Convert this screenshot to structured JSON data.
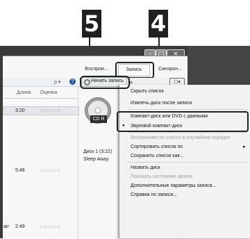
{
  "callouts": {
    "left": "5",
    "right": "4"
  },
  "window": {
    "title_buttons": {
      "minimize": "–",
      "maximize": "□",
      "close": "×"
    }
  },
  "tabs": {
    "play": "Воспрои...",
    "burn": "Запись",
    "sync": "Синхрон..."
  },
  "toolbar": {
    "search_glyph": "ρ ▾",
    "help_glyph": "?",
    "start_burn": "Начать запись",
    "more": "»",
    "options_glyph": "☐▾"
  },
  "columns": {
    "length": "Длина",
    "rating": "Оценка"
  },
  "tracks": [
    {
      "prefix": "",
      "length": "3:20",
      "stars": "☆☆☆☆☆"
    },
    {
      "prefix": "",
      "length": "5:48",
      "stars": "☆☆☆☆☆"
    },
    {
      "prefix": "air",
      "length": "2:49",
      "stars": "☆☆☆☆☆"
    }
  ],
  "cd": {
    "label": "CD R"
  },
  "burn_list": {
    "disc": "Диск 1 (3:22)",
    "track": "Sleep Away"
  },
  "menu": {
    "hide_list": "Скрыть список",
    "eject_after": "Извлечь диск после записи",
    "data_disc": "Компакт-диск или DVD с данными",
    "audio_cd": "Звуковой компакт-диск",
    "bullet": "●",
    "shuffle": "Воспроизвести список в случайном порядке",
    "sort": "Сортировать список по",
    "submenu_arrow": "▸",
    "save_as": "Сохранить список как...",
    "name_disc": "Назвать диск",
    "show_status": "Показать состояние записи",
    "advanced": "Дополнительные параметры записи...",
    "help": "Справка по записи..."
  }
}
